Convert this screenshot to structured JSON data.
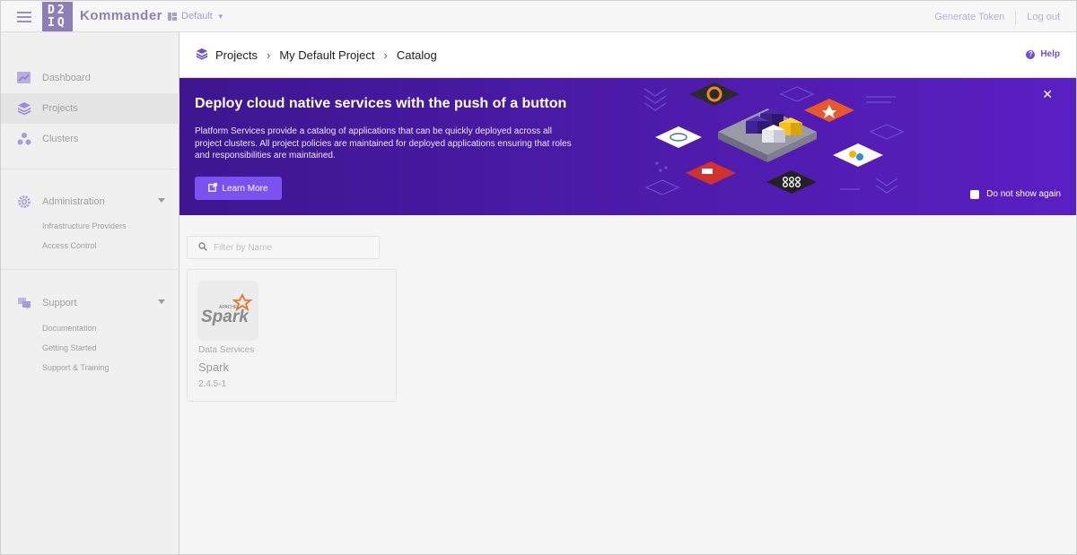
{
  "topbar": {
    "logo_text_1": "D2",
    "logo_text_2": "IQ",
    "brand": "Kommander",
    "workspace": "Default",
    "generate_token": "Generate Token",
    "logout": "Log out"
  },
  "sidebar": {
    "items": [
      {
        "label": "Dashboard",
        "icon": "dashboard-icon"
      },
      {
        "label": "Projects",
        "icon": "layers-icon"
      },
      {
        "label": "Clusters",
        "icon": "clusters-icon"
      }
    ],
    "administration": {
      "label": "Administration",
      "children": [
        "Infrastructure Providers",
        "Access Control"
      ]
    },
    "support": {
      "label": "Support",
      "children": [
        "Documentation",
        "Getting Started",
        "Support & Training"
      ]
    }
  },
  "breadcrumb": {
    "items": [
      "Projects",
      "My Default Project",
      "Catalog"
    ],
    "help": "Help"
  },
  "banner": {
    "title": "Deploy cloud native services with the push of a button",
    "body": "Platform Services provide a catalog of applications that can be quickly deployed across all project clusters. All project policies are maintained for deployed applications ensuring that roles and responsibilities are maintained.",
    "cta": "Learn More",
    "dont_show": "Do not show again"
  },
  "filter": {
    "placeholder": "Filter by Name",
    "value": ""
  },
  "catalog": [
    {
      "category": "Data Services",
      "name": "Spark",
      "version": "2.4.5-1",
      "logo_apache": "APACHE",
      "logo_name": "Spark"
    }
  ],
  "colors": {
    "accent": "#6d4fd8",
    "banner": "#4b1aa6",
    "brand": "#8d7fb6"
  }
}
